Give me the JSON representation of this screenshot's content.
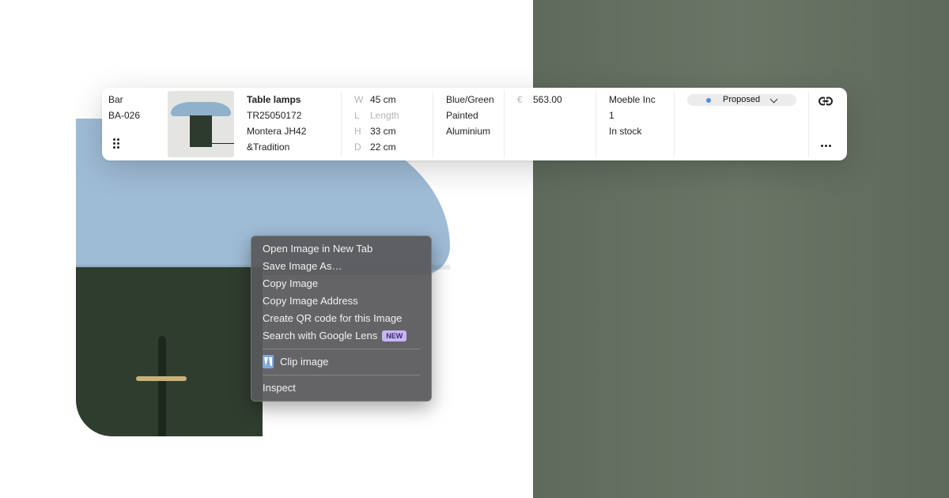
{
  "colors": {
    "right_panel": "#65705f",
    "status_dot": "#4b8fe8",
    "badge_bg": "#c8b6f4",
    "menu_bg": "#58585a"
  },
  "row": {
    "area": "Bar",
    "code": "BA-026",
    "product": {
      "category": "Table lamps",
      "sku": "TR25050172",
      "model": "Montera JH42",
      "brand": "&Tradition"
    },
    "dimensions": [
      {
        "label": "W",
        "value": "45 cm"
      },
      {
        "label": "L",
        "value": "Length"
      },
      {
        "label": "H",
        "value": "33 cm"
      },
      {
        "label": "D",
        "value": "22 cm"
      }
    ],
    "materials": [
      "Blue/Green",
      "Painted",
      "Aluminium"
    ],
    "price": {
      "currency": "€",
      "amount": "563.00"
    },
    "supplier": {
      "name": "Moeble Inc",
      "quantity": "1",
      "stock": "In stock"
    },
    "status": "Proposed",
    "icons": {
      "drag": "drag-handle-icon",
      "link": "link-icon",
      "more": "more-dots-icon"
    }
  },
  "context_menu": {
    "items": [
      "Open Image in New Tab",
      "Save Image As…",
      "Copy Image",
      "Copy Image Address",
      "Create QR code for this Image",
      "Search with Google Lens"
    ],
    "new_badge": "NEW",
    "clip_label": "Clip image",
    "inspect_label": "Inspect"
  }
}
